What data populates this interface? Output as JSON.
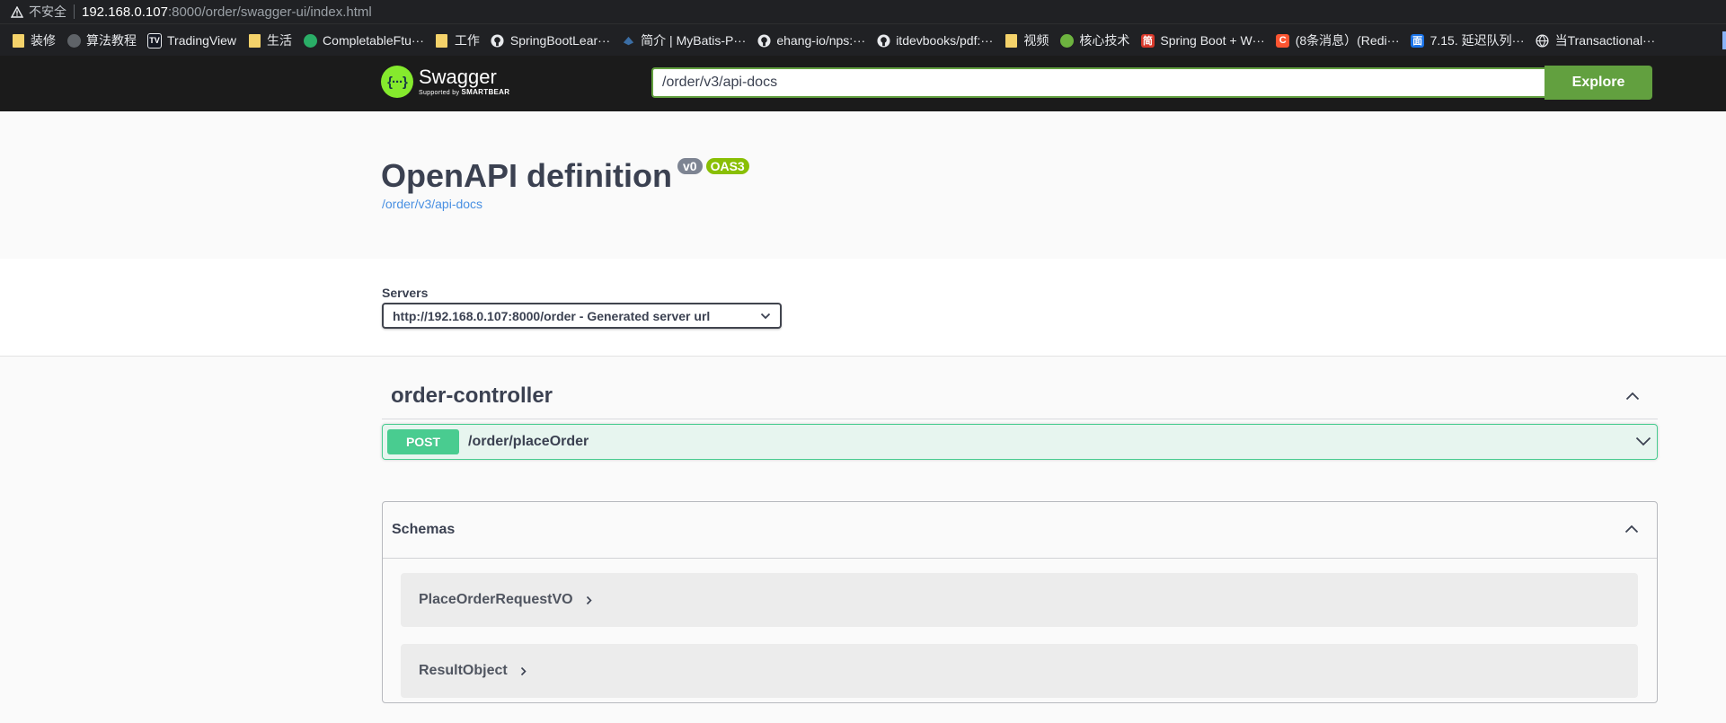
{
  "browser": {
    "insecure_label": "不安全",
    "url_host": "192.168.0.107",
    "url_path": ":8000/order/swagger-ui/index.html",
    "bookmarks": [
      {
        "label": "装修",
        "icon": "folder-icon"
      },
      {
        "label": "算法教程",
        "icon": "globe-icon"
      },
      {
        "label": "TradingView",
        "icon": "tradingview-icon"
      },
      {
        "label": "生活",
        "icon": "folder-icon"
      },
      {
        "label": "CompletableFtu···",
        "icon": "wechat-icon"
      },
      {
        "label": "工作",
        "icon": "folder-icon"
      },
      {
        "label": "SpringBootLear···",
        "icon": "github-icon"
      },
      {
        "label": "简介 | MyBatis-P···",
        "icon": "mybatis-icon"
      },
      {
        "label": "ehang-io/nps:···",
        "icon": "github-icon"
      },
      {
        "label": "itdevbooks/pdf:···",
        "icon": "github-icon"
      },
      {
        "label": "视频",
        "icon": "folder-icon"
      },
      {
        "label": "核心技术",
        "icon": "spring-icon"
      },
      {
        "label": "Spring Boot + W···",
        "icon": "juejin-icon"
      },
      {
        "label": "(8条消息）(Redi···",
        "icon": "csdn-icon"
      },
      {
        "label": "7.15. 延迟队列···",
        "icon": "doc-icon"
      },
      {
        "label": "当Transactional···",
        "icon": "globe-icon"
      }
    ]
  },
  "topbar": {
    "logo_name": "Swagger",
    "logo_sub_prefix": "Supported by",
    "logo_sub_brand": "SMARTBEAR",
    "url_value": "/order/v3/api-docs",
    "explore_label": "Explore"
  },
  "info": {
    "title": "OpenAPI definition",
    "version_badge": "v0",
    "oas_badge": "OAS3",
    "spec_link": "/order/v3/api-docs"
  },
  "servers": {
    "label": "Servers",
    "selected": "http://192.168.0.107:8000/order - Generated server url"
  },
  "tag": {
    "name": "order-controller"
  },
  "operation": {
    "method": "POST",
    "path": "/order/placeOrder"
  },
  "schemas": {
    "title": "Schemas",
    "models": [
      "PlaceOrderRequestVO",
      "ResultObject"
    ]
  },
  "colors": {
    "topbar_bg": "#1b1b1b",
    "accent_green": "#62a03f",
    "post_green": "#49cc90",
    "oas_badge": "#89bf04",
    "version_badge": "#7d8492",
    "link_blue": "#4990e2"
  }
}
